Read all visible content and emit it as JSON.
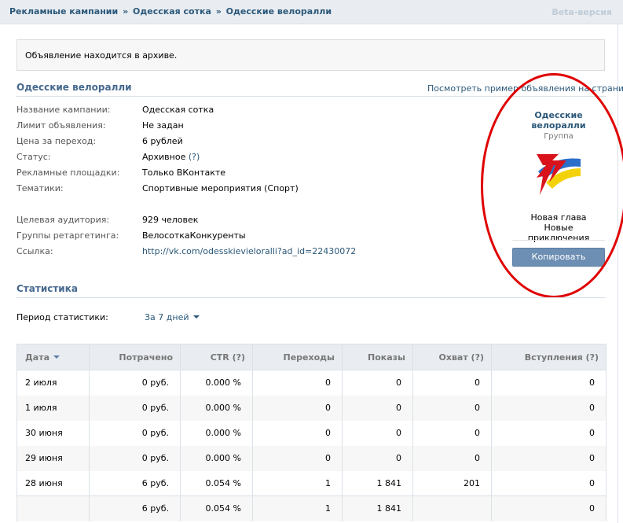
{
  "breadcrumb": [
    "Рекламные кампании",
    "Одесская сотка",
    "Одесские велоралли"
  ],
  "breadcrumb_sep": "»",
  "beta": "Beta-версия",
  "notice": "Объявление находится в архиве.",
  "ad": {
    "title": "Одесские велоралли",
    "preview_link": "Посмотреть пример объявления на странице"
  },
  "props": [
    {
      "label": "Название кампании:",
      "value": "Одесская сотка"
    },
    {
      "label": "Лимит объявления:",
      "value": "Не задан"
    },
    {
      "label": "Цена за переход:",
      "value": "6 рублей"
    },
    {
      "label": "Статус:",
      "value": "Архивное",
      "qm": "(?)"
    },
    {
      "label": "Рекламные площадки:",
      "value": "Только ВКонтакте"
    },
    {
      "label": "Тематики:",
      "value": "Спортивные мероприятия (Спорт)"
    },
    {
      "label": "Целевая аудитория:",
      "value": "929 человек"
    },
    {
      "label": "Группы ретаргетинга:",
      "value": "ВелосоткаКонкуренты"
    },
    {
      "label": "Ссылка:",
      "value": "http://vk.com/odesskievieloralli?ad_id=22430072"
    }
  ],
  "preview": {
    "title_line1": "Одесские",
    "title_line2": "велоралли",
    "subtitle": "Группа",
    "text_line1": "Новая глава",
    "text_line2": "Новые приключения",
    "copy_button": "Копировать",
    "logo_icon": "star-flag-logo"
  },
  "stats": {
    "title": "Статистика",
    "period_label": "Период статистики:",
    "period_value": "За 7 дней",
    "headers": [
      "Дата",
      "Потрачено",
      "CTR (?)",
      "Переходы",
      "Показы",
      "Охват (?)",
      "Вступления (?)"
    ],
    "rows": [
      [
        "2 июля",
        "0 руб.",
        "0.000 %",
        "0",
        "0",
        "0",
        "0"
      ],
      [
        "1 июля",
        "0 руб.",
        "0.000 %",
        "0",
        "0",
        "0",
        "0"
      ],
      [
        "30 июня",
        "0 руб.",
        "0.000 %",
        "0",
        "0",
        "0",
        "0"
      ],
      [
        "29 июня",
        "0 руб.",
        "0.000 %",
        "0",
        "0",
        "0",
        "0"
      ],
      [
        "28 июня",
        "6 руб.",
        "0.054 %",
        "1",
        "1 841",
        "201",
        "0"
      ]
    ],
    "total": [
      "",
      "6 руб.",
      "0.054 %",
      "1",
      "1 841",
      "",
      "0"
    ]
  },
  "colors": {
    "accent": "#2b587a",
    "header_bg": "#e9edf1",
    "button": "#6d8fb3",
    "annotation": "#e00000"
  }
}
